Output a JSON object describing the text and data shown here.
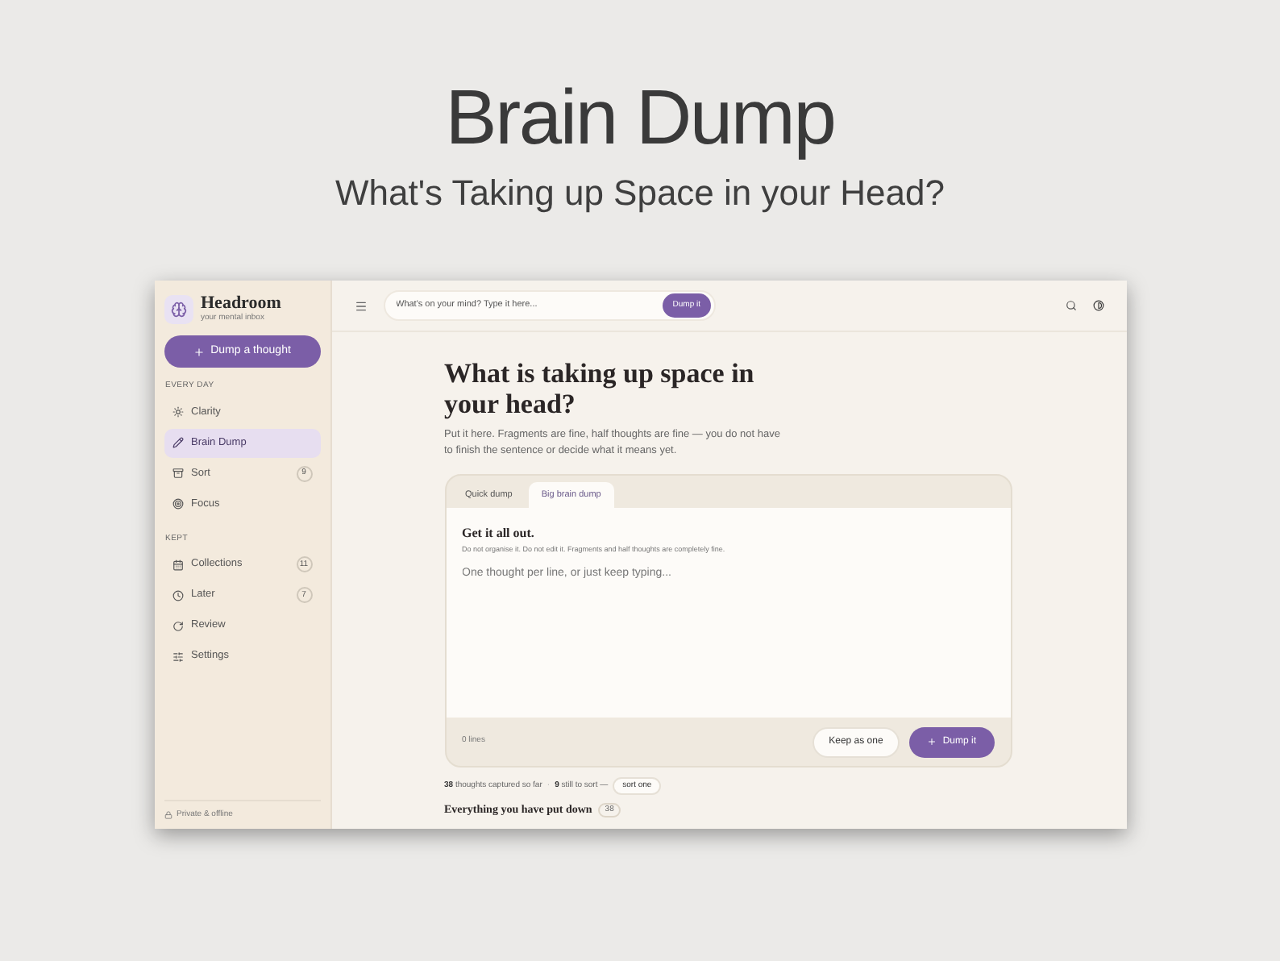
{
  "page_title": "Brain Dump",
  "page_subtitle": "What's Taking up Space in your Head?",
  "brand": {
    "name": "Headroom",
    "tagline": "your mental inbox"
  },
  "new_button": "Dump a thought",
  "sidebar": {
    "sections": [
      {
        "heading": "EVERY DAY",
        "items": [
          {
            "label": "Clarity",
            "selected": false
          },
          {
            "label": "Brain Dump",
            "selected": true
          },
          {
            "label": "Sort",
            "selected": false,
            "count": "9"
          },
          {
            "label": "Focus",
            "selected": false
          }
        ]
      },
      {
        "heading": "KEPT",
        "items": [
          {
            "label": "Collections",
            "selected": false,
            "count": "11"
          },
          {
            "label": "Later",
            "selected": false,
            "count": "7"
          },
          {
            "label": "Review",
            "selected": false
          },
          {
            "label": "Settings",
            "selected": false
          }
        ]
      }
    ],
    "footer": "Private & offline"
  },
  "topbar": {
    "placeholder": "What's on your mind? Type it here...",
    "button": "Dump it"
  },
  "main": {
    "heading": "What is taking up space in your head?",
    "intro": "Put it here. Fragments are fine, half thoughts are fine — you do not have to finish the sentence or decide what it means yet.",
    "tabs": [
      {
        "label": "Quick dump",
        "selected": false
      },
      {
        "label": "Big brain dump",
        "selected": true
      }
    ],
    "card_title": "Get it all out.",
    "card_hint": "Do not organise it. Do not edit it. Fragments and half thoughts are completely fine.",
    "placeholder": "One thought per line, or just keep typing...",
    "line_count": "0 lines",
    "secondary_button": "Keep as one",
    "primary_button": "Dump it",
    "stats": {
      "captured": "38",
      "captured_label": "thoughts captured so far",
      "separator": "·",
      "to_sort": "9",
      "to_sort_label": "still to sort —",
      "action": "sort one"
    },
    "next_heading": "Everything you have put down",
    "next_count": "38"
  }
}
